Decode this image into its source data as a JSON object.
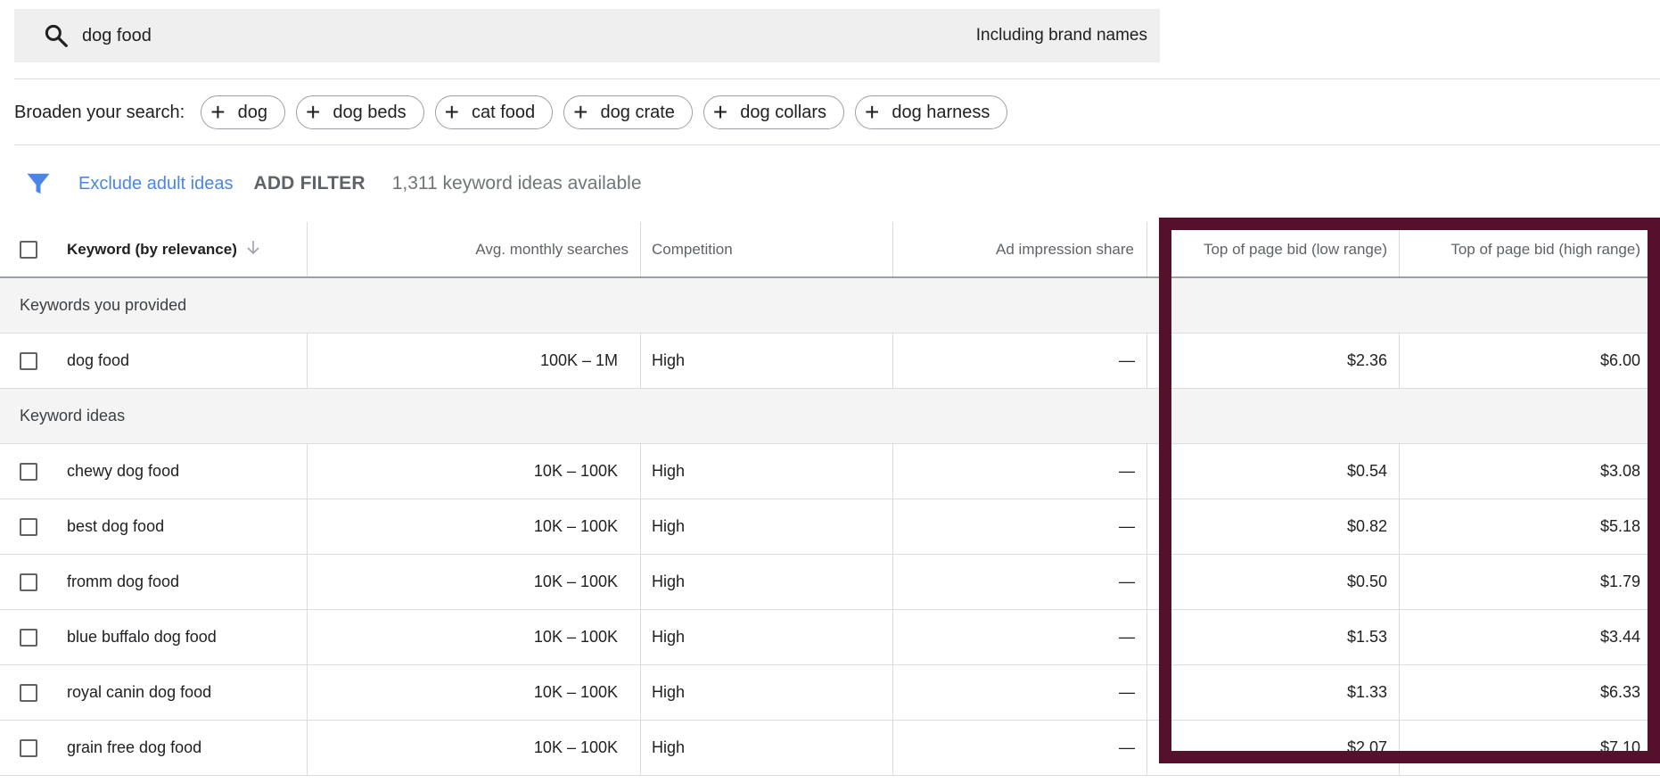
{
  "search": {
    "query": "dog food",
    "brand_toggle": "Including brand names",
    "icon": "search-icon"
  },
  "broaden": {
    "label": "Broaden your search:",
    "chips": [
      "dog",
      "dog beds",
      "cat food",
      "dog crate",
      "dog collars",
      "dog harness"
    ]
  },
  "filters": {
    "exclude_adult": "Exclude adult ideas",
    "add_filter": "ADD FILTER",
    "available": "1,311 keyword ideas available",
    "filter_icon_color": "#4a86e8"
  },
  "table": {
    "columns": {
      "keyword": "Keyword (by relevance)",
      "searches": "Avg. monthly searches",
      "competition": "Competition",
      "impression": "Ad impression share",
      "bid_low": "Top of page bid (low range)",
      "bid_high": "Top of page bid (high range)"
    },
    "groups": {
      "provided": "Keywords you provided",
      "ideas": "Keyword ideas"
    },
    "provided_rows": [
      {
        "keyword": "dog food",
        "searches": "100K – 1M",
        "competition": "High",
        "impression": "—",
        "bid_low": "$2.36",
        "bid_high": "$6.00"
      }
    ],
    "idea_rows": [
      {
        "keyword": "chewy dog food",
        "searches": "10K – 100K",
        "competition": "High",
        "impression": "—",
        "bid_low": "$0.54",
        "bid_high": "$3.08"
      },
      {
        "keyword": "best dog food",
        "searches": "10K – 100K",
        "competition": "High",
        "impression": "—",
        "bid_low": "$0.82",
        "bid_high": "$5.18"
      },
      {
        "keyword": "fromm dog food",
        "searches": "10K – 100K",
        "competition": "High",
        "impression": "—",
        "bid_low": "$0.50",
        "bid_high": "$1.79"
      },
      {
        "keyword": "blue buffalo dog food",
        "searches": "10K – 100K",
        "competition": "High",
        "impression": "—",
        "bid_low": "$1.53",
        "bid_high": "$3.44"
      },
      {
        "keyword": "royal canin dog food",
        "searches": "10K – 100K",
        "competition": "High",
        "impression": "—",
        "bid_low": "$1.33",
        "bid_high": "$6.33"
      },
      {
        "keyword": "grain free dog food",
        "searches": "10K – 100K",
        "competition": "High",
        "impression": "—",
        "bid_low": "$2.07",
        "bid_high": "$7.10"
      }
    ]
  },
  "highlight_color": "#55102c"
}
